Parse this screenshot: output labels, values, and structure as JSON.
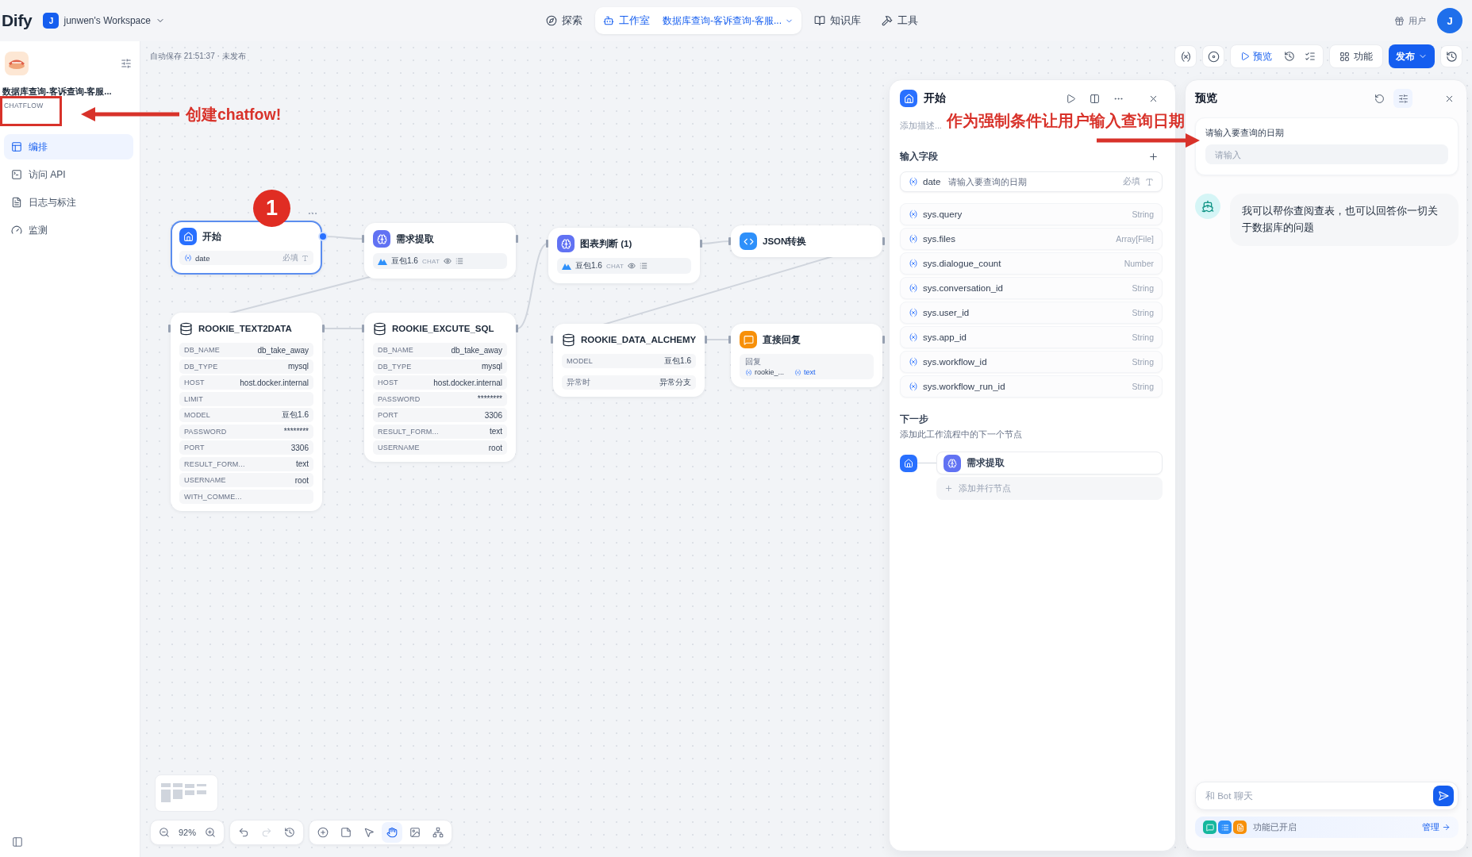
{
  "header": {
    "logo": "Dify",
    "workspace": {
      "initial": "J",
      "name": "junwen's Workspace"
    },
    "nav": [
      {
        "kind": "explore",
        "label": "探索",
        "selected": false
      },
      {
        "kind": "studio",
        "label": "工作室",
        "selected": true,
        "app": "数据库查询-客诉查询-客服..."
      },
      {
        "kind": "knowledge",
        "label": "知识库",
        "selected": false
      },
      {
        "kind": "tools",
        "label": "工具",
        "selected": false
      }
    ],
    "account": {
      "label": "用户",
      "avatar": "J"
    }
  },
  "sidebar": {
    "app": {
      "name": "数据库查询-客诉查询-客服...",
      "mode": "CHATFLOW"
    },
    "items": [
      {
        "kind": "orchestrate",
        "label": "编排",
        "selected": true
      },
      {
        "kind": "api",
        "label": "访问 API",
        "selected": false
      },
      {
        "kind": "logs",
        "label": "日志与标注",
        "selected": false
      },
      {
        "kind": "monitor",
        "label": "监测",
        "selected": false
      }
    ]
  },
  "canvas": {
    "autosave": "自动保存 21:51:37 · 未发布",
    "actions": {
      "preview": "预览",
      "features": "功能",
      "publish": "发布"
    },
    "nodes": [
      {
        "kind": "start",
        "title": "开始",
        "selected": true,
        "variables": [
          {
            "name": "date",
            "tag": "必填"
          }
        ]
      },
      {
        "kind": "llm",
        "title": "需求提取",
        "selected": false,
        "model": "豆包1.6",
        "mode": "CHAT"
      },
      {
        "kind": "llm",
        "title": "图表判断 (1)",
        "selected": false,
        "model": "豆包1.6",
        "mode": "CHAT"
      },
      {
        "kind": "code",
        "title": "JSON转换",
        "selected": false
      },
      {
        "kind": "tool",
        "title": "ROOKIE_TEXT2DATA",
        "selected": false,
        "params": [
          {
            "key": "DB_NAME",
            "value": "db_take_away"
          },
          {
            "key": "DB_TYPE",
            "value": "mysql"
          },
          {
            "key": "HOST",
            "value": "host.docker.internal"
          },
          {
            "key": "LIMIT"
          },
          {
            "key": "MODEL",
            "value": "豆包1.6"
          },
          {
            "key": "PASSWORD",
            "value": "********"
          },
          {
            "key": "PORT",
            "value": "3306"
          },
          {
            "key": "RESULT_FORM...",
            "value": "text"
          },
          {
            "key": "USERNAME",
            "value": "root"
          },
          {
            "key": "WITH_COMME..."
          }
        ]
      },
      {
        "kind": "tool",
        "title": "ROOKIE_EXCUTE_SQL",
        "selected": false,
        "params": [
          {
            "key": "DB_NAME",
            "value": "db_take_away"
          },
          {
            "key": "DB_TYPE",
            "value": "mysql"
          },
          {
            "key": "HOST",
            "value": "host.docker.internal"
          },
          {
            "key": "PASSWORD",
            "value": "********"
          },
          {
            "key": "PORT",
            "value": "3306"
          },
          {
            "key": "RESULT_FORM...",
            "value": "text"
          },
          {
            "key": "USERNAME",
            "value": "root"
          }
        ]
      },
      {
        "kind": "tool",
        "title": "ROOKIE_DATA_ALCHEMY",
        "selected": false,
        "params": [
          {
            "key": "MODEL",
            "value": "豆包1.6"
          }
        ],
        "error": {
          "label": "异常时",
          "value": "异常分支"
        }
      },
      {
        "kind": "answer",
        "title": "直接回复",
        "selected": false,
        "label": "回复",
        "refs": [
          "rookie_...",
          "text"
        ]
      }
    ],
    "zoom": "92%",
    "modes": [
      {
        "kind": "pointer",
        "selected": false
      },
      {
        "kind": "hand",
        "selected": true
      }
    ]
  },
  "start_panel": {
    "title": "开始",
    "description": {
      "placeholder": "添加描述..."
    },
    "inputs_title": "输入字段",
    "variables": [
      {
        "name": "date",
        "label": "请输入要查询的日期",
        "tag": "必填"
      }
    ],
    "system_variables": [
      {
        "name": "sys.query",
        "type": "String"
      },
      {
        "name": "sys.files",
        "type": "Array[File]"
      },
      {
        "name": "sys.dialogue_count",
        "type": "Number"
      },
      {
        "name": "sys.conversation_id",
        "type": "String"
      },
      {
        "name": "sys.user_id",
        "type": "String"
      },
      {
        "name": "sys.app_id",
        "type": "String"
      },
      {
        "name": "sys.workflow_id",
        "type": "String"
      },
      {
        "name": "sys.workflow_run_id",
        "type": "String"
      }
    ],
    "next": {
      "title": "下一步",
      "subtitle": "添加此工作流程中的下一个节点",
      "node": "需求提取",
      "add_parallel": "添加并行节点"
    }
  },
  "preview_panel": {
    "title": "预览",
    "form": {
      "label": "请输入要查询的日期",
      "placeholder": "请输入"
    },
    "messages": [
      {
        "text": "我可以帮你查阅查表，也可以回答你一切关于数据库的问题"
      }
    ],
    "chat_input": {
      "placeholder": "和 Bot 聊天"
    },
    "features": {
      "label": "功能已开启",
      "manage": "管理"
    }
  },
  "annotations": [
    {
      "kind": "step",
      "text": "1"
    },
    {
      "kind": "callout",
      "text": "创建chatfow!"
    },
    {
      "kind": "callout",
      "text": "作为强制条件让用户输入查询日期"
    }
  ]
}
